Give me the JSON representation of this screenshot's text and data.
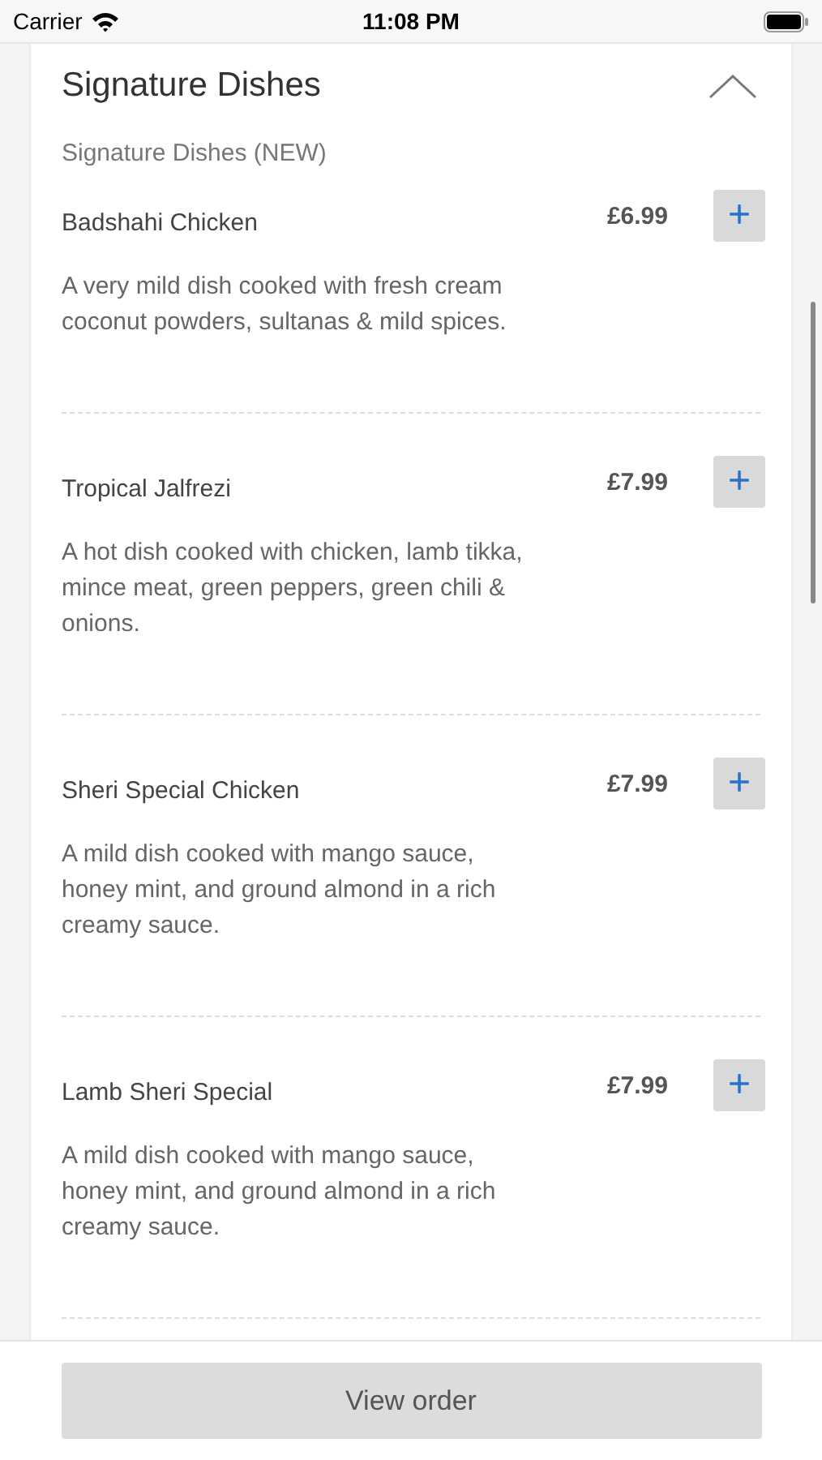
{
  "status_bar": {
    "carrier": "Carrier",
    "time": "11:08 PM"
  },
  "section": {
    "title": "Signature Dishes",
    "expanded": true,
    "subtitle": "Signature Dishes (NEW)"
  },
  "dishes": [
    {
      "name": "Badshahi Chicken",
      "price": "£6.99",
      "add": "+",
      "description": "A very mild dish cooked with fresh cream coconut powders, sultanas & mild spices."
    },
    {
      "name": "Tropical Jalfrezi",
      "price": "£7.99",
      "add": "+",
      "description": "A hot dish cooked with chicken, lamb tikka, mince meat, green peppers, green chili & onions."
    },
    {
      "name": "Sheri Special Chicken",
      "price": "£7.99",
      "add": "+",
      "description": "A mild dish cooked with mango sauce, honey mint, and ground almond in a rich creamy sauce."
    },
    {
      "name": "Lamb Sheri Special",
      "price": "£7.99",
      "add": "+",
      "description": "A mild dish cooked with mango sauce, honey mint, and ground almond in a rich creamy sauce."
    }
  ],
  "footer": {
    "button": "View order"
  }
}
